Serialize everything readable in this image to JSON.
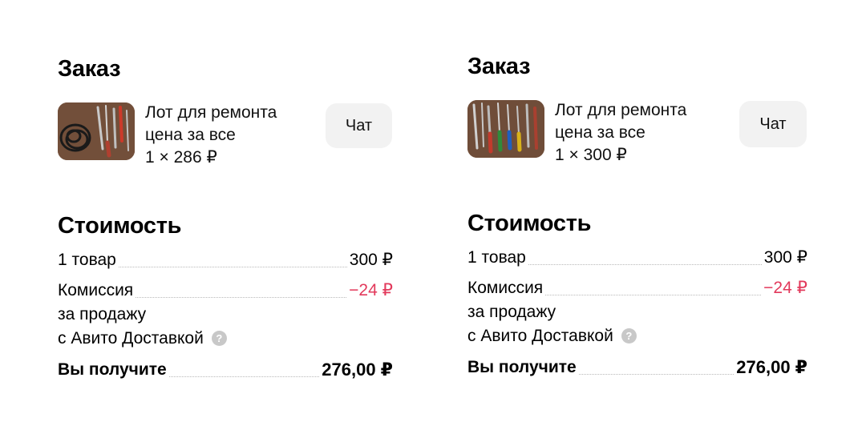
{
  "orders": [
    {
      "title": "Заказ",
      "item": {
        "line1": "Лот для ремонта",
        "line2": "цена за все",
        "qty_price": "1 × 286 ₽",
        "thumb_icon": "tools-photo"
      },
      "chat_label": "Чат",
      "cost_title": "Стоимость",
      "goods_label": "1 товар",
      "goods_value": "300 ₽",
      "commission_label_1": "Комиссия",
      "commission_label_2": "за продажу",
      "commission_label_3": "с Авито Доставкой",
      "commission_value": "−24 ₽",
      "help_icon": "?",
      "total_label": "Вы получите",
      "total_value": "276,00 ₽"
    },
    {
      "title": "Заказ",
      "item": {
        "line1": "Лот для ремонта",
        "line2": "цена за все",
        "qty_price": "1 × 300 ₽",
        "thumb_icon": "tools-photo"
      },
      "chat_label": "Чат",
      "cost_title": "Стоимость",
      "goods_label": "1 товар",
      "goods_value": "300 ₽",
      "commission_label_1": "Комиссия",
      "commission_label_2": "за продажу",
      "commission_label_3": "с Авито Доставкой",
      "commission_value": "−24 ₽",
      "help_icon": "?",
      "total_label": "Вы получите",
      "total_value": "276,00 ₽"
    }
  ],
  "colors": {
    "negative": "#e2395b",
    "button_bg": "#f2f2f2",
    "dots": "#b9b9b9"
  }
}
